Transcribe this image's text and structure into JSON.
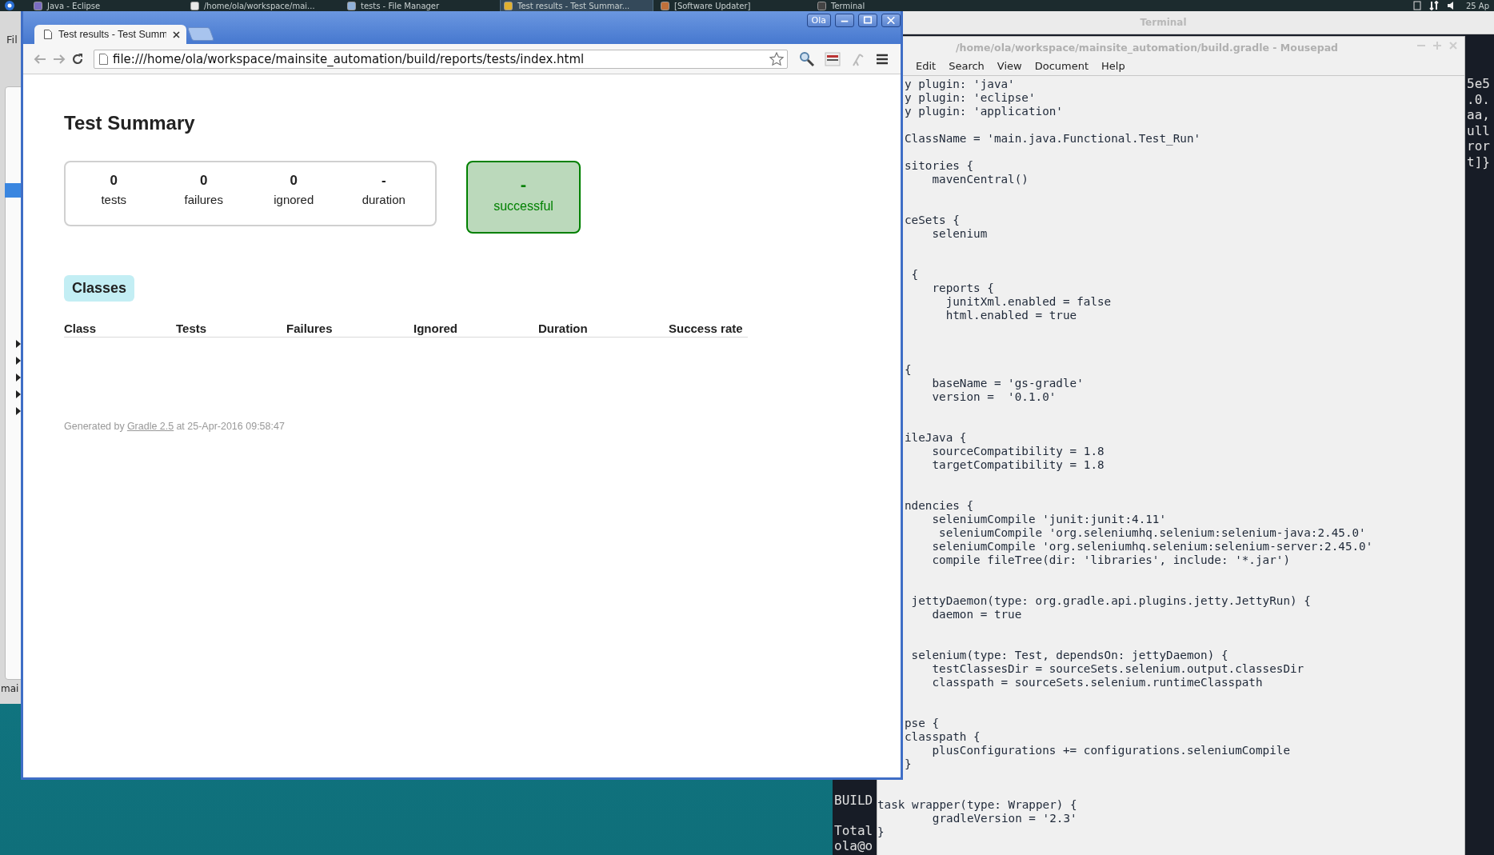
{
  "taskbar": {
    "items": [
      {
        "label": "Java - Eclipse",
        "selected": false
      },
      {
        "label": "/home/ola/workspace/mai...",
        "selected": false
      },
      {
        "label": "tests - File Manager",
        "selected": false
      },
      {
        "label": "Test results - Test Summar...",
        "selected": true
      },
      {
        "label": "[Software Updater]",
        "selected": false
      },
      {
        "label": "Terminal",
        "selected": false
      }
    ],
    "clock": "25 Ap"
  },
  "eclipse_window": {
    "menu_label": "Fil",
    "status_text": "mai"
  },
  "terminal_window": {
    "title": "Terminal",
    "output_right": [
      "5e5",
      ".0.",
      "aa,",
      "ull",
      "ror",
      "t]}"
    ],
    "output_left": [
      "BUILD",
      "Total",
      "ola@o"
    ]
  },
  "editor_window": {
    "title": "/home/ola/workspace/mainsite_automation/build.gradle - Mousepad",
    "menus": [
      "Edit",
      "Search",
      "View",
      "Document",
      "Help"
    ],
    "code_upper": "y plugin: 'java'\ny plugin: 'eclipse'\ny plugin: 'application'\n\nClassName = 'main.java.Functional.Test_Run'\n\nsitories {\n    mavenCentral()\n\n\nceSets {\n    selenium\n\n\n {\n    reports {\n      junitXml.enabled = false\n      html.enabled = true\n\n\n\n{\n    baseName = 'gs-gradle'\n    version =  '0.1.0'\n\n\nileJava {\n    sourceCompatibility = 1.8\n    targetCompatibility = 1.8\n\n\nndencies {\n    seleniumCompile 'junit:junit:4.11'\n     seleniumCompile 'org.seleniumhq.selenium:selenium-java:2.45.0'\n    seleniumCompile 'org.seleniumhq.selenium:selenium-server:2.45.0'\n    compile fileTree(dir: 'libraries', include: '*.jar')\n\n\n jettyDaemon(type: org.gradle.api.plugins.jetty.JettyRun) {\n    daemon = true\n\n\n selenium(type: Test, dependsOn: jettyDaemon) {\n    testClassesDir = sourceSets.selenium.output.classesDir\n    classpath = sourceSets.selenium.runtimeClasspath\n\n\npse {\nclasspath {\n    plusConfigurations += configurations.seleniumCompile\n}",
    "code_lower": "task wrapper(type: Wrapper) {\n        gradleVersion = '2.3'\n}"
  },
  "browser_window": {
    "profile": "Ola",
    "tabs": [
      {
        "title": "Test results - Test Summ",
        "selected": true
      }
    ],
    "url": "file:///home/ola/workspace/mainsite_automation/build/reports/tests/index.html",
    "page": {
      "title": "Test Summary",
      "counters": [
        {
          "value": "0",
          "label": "tests"
        },
        {
          "value": "0",
          "label": "failures"
        },
        {
          "value": "0",
          "label": "ignored"
        },
        {
          "value": "-",
          "label": "duration"
        }
      ],
      "result": {
        "value": "-",
        "label": "successful",
        "success": true
      },
      "section_tabs": [
        {
          "label": "Classes",
          "selected": true
        }
      ],
      "columns": [
        "Class",
        "Tests",
        "Failures",
        "Ignored",
        "Duration",
        "Success rate"
      ],
      "footer": {
        "before": "Generated by",
        "link": "Gradle 2.5",
        "after": "at 25-Apr-2016 09:58:47"
      }
    }
  }
}
